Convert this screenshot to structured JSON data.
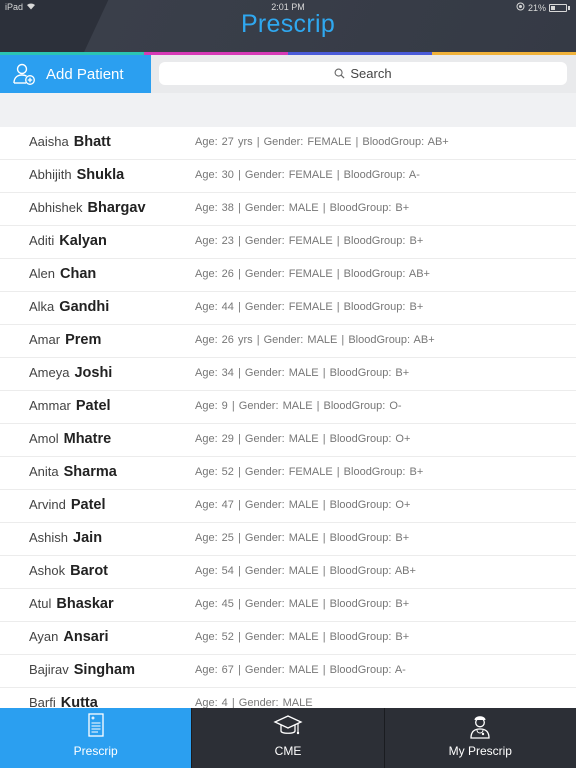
{
  "status_bar": {
    "device": "iPad",
    "time": "2:01 PM",
    "battery": "21%"
  },
  "app": {
    "title": "Prescrip"
  },
  "colors": {
    "accent": "#2b9ff0",
    "title": "#2fa8f0",
    "header_bg": "#2c303a",
    "tabbar_bg": "#2c2f36",
    "strip": [
      "#2bc4b4",
      "#d63ab6",
      "#4a5bd8",
      "#f0b23a"
    ]
  },
  "toolbar": {
    "add_patient_label": "Add Patient",
    "add_patient_icon": "add-user-icon",
    "search_placeholder": "Search",
    "search_icon": "search-icon"
  },
  "patients": [
    {
      "first": "Aaisha",
      "last": "Bhatt",
      "details": "Age:  27 yrs  |   Gender:  FEMALE   |   BloodGroup:  AB+"
    },
    {
      "first": "Abhijith",
      "last": "Shukla",
      "details": "Age:  30  |   Gender:  FEMALE   |   BloodGroup:  A-"
    },
    {
      "first": "Abhishek",
      "last": "Bhargav",
      "details": "Age:  38  |   Gender:  MALE   |   BloodGroup:  B+"
    },
    {
      "first": "Aditi",
      "last": "Kalyan",
      "details": "Age:  23  |   Gender:  FEMALE   |   BloodGroup:  B+"
    },
    {
      "first": "Alen",
      "last": "Chan",
      "details": "Age:  26  |   Gender:  FEMALE   |   BloodGroup:  AB+"
    },
    {
      "first": "Alka",
      "last": "Gandhi",
      "details": "Age:  44  |   Gender:  FEMALE   |   BloodGroup:  B+"
    },
    {
      "first": "Amar",
      "last": "Prem",
      "details": "Age:  26 yrs  |   Gender:  MALE   |   BloodGroup:  AB+"
    },
    {
      "first": "Ameya",
      "last": "Joshi",
      "details": "Age:  34  |   Gender:  MALE   |   BloodGroup:  B+"
    },
    {
      "first": "Ammar",
      "last": "Patel",
      "details": "Age:  9  |   Gender:  MALE   |   BloodGroup:  O-"
    },
    {
      "first": "Amol",
      "last": "Mhatre",
      "details": "Age:  29  |   Gender:  MALE   |   BloodGroup:  O+"
    },
    {
      "first": "Anita",
      "last": "Sharma",
      "details": "Age:  52  |   Gender:  FEMALE   |   BloodGroup:  B+"
    },
    {
      "first": "Arvind",
      "last": "Patel",
      "details": "Age:  47  |   Gender:  MALE   |   BloodGroup:  O+"
    },
    {
      "first": "Ashish",
      "last": "Jain",
      "details": "Age:  25  |   Gender:  MALE   |   BloodGroup:  B+"
    },
    {
      "first": "Ashok",
      "last": "Barot",
      "details": "Age:  54  |   Gender:  MALE   |   BloodGroup:  AB+"
    },
    {
      "first": "Atul",
      "last": "Bhaskar",
      "details": "Age:  45  |   Gender:  MALE   |   BloodGroup:  B+"
    },
    {
      "first": "Ayan",
      "last": "Ansari",
      "details": "Age:  52  |   Gender:  MALE   |   BloodGroup:  B+"
    },
    {
      "first": "Bajirav",
      "last": "Singham",
      "details": "Age:  67  |   Gender:  MALE   |   BloodGroup:  A-"
    },
    {
      "first": "Barfi",
      "last": "Kutta",
      "details": "Age:  4  |   Gender:  MALE"
    }
  ],
  "tabbar": {
    "tabs": [
      {
        "label": "Prescrip",
        "icon": "prescription-pad-icon",
        "active": true
      },
      {
        "label": "CME",
        "icon": "graduation-cap-icon",
        "active": false
      },
      {
        "label": "My Prescrip",
        "icon": "doctor-icon",
        "active": false
      }
    ]
  }
}
